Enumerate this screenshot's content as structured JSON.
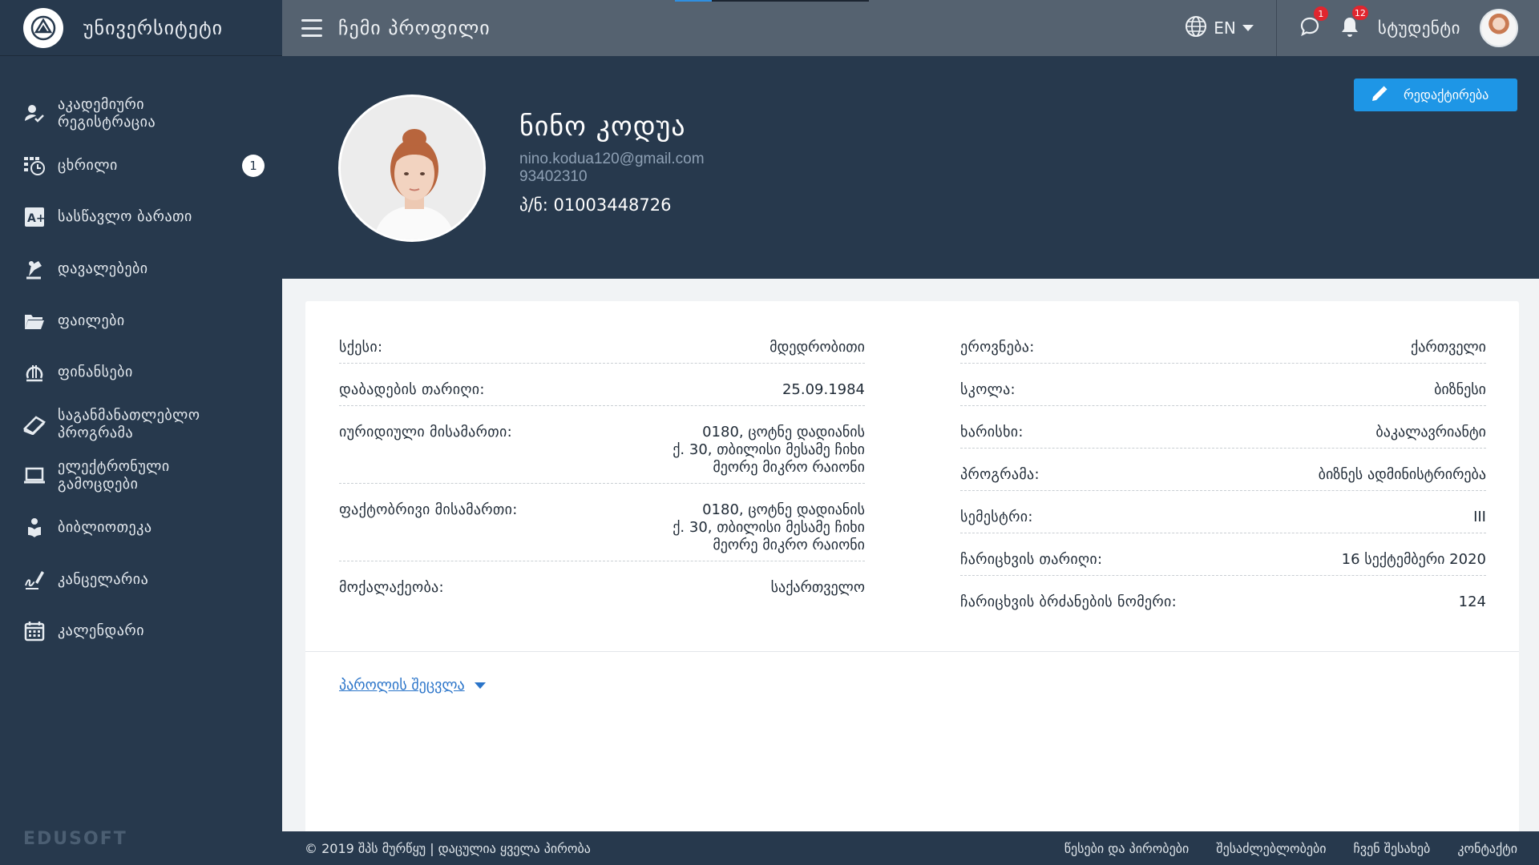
{
  "brand": {
    "name": "უნივერსიტეტი",
    "footer_logo": "EDUSOFT"
  },
  "topbar": {
    "title": "ჩემი პროფილი",
    "language": "EN",
    "messages_count": "1",
    "notifications_count": "12",
    "user_label": "სტუდენტი"
  },
  "sidebar": {
    "items": [
      {
        "label": "აკადემიური რეგისტრაცია",
        "icon": "user-check-icon"
      },
      {
        "label": "ცხრილი",
        "icon": "schedule-icon",
        "badge": "1"
      },
      {
        "label": "სასწავლო ბარათი",
        "icon": "grade-card-icon"
      },
      {
        "label": "დავალებები",
        "icon": "assignment-icon"
      },
      {
        "label": "ფაილები",
        "icon": "folder-icon"
      },
      {
        "label": "ფინანსები",
        "icon": "finance-icon"
      },
      {
        "label": "საგანმანათლებლო პროგრამა",
        "icon": "book-icon"
      },
      {
        "label": "ელექტრონული გამოცდები",
        "icon": "laptop-icon"
      },
      {
        "label": "ბიბლიოთეკა",
        "icon": "reader-icon"
      },
      {
        "label": "კანცელარია",
        "icon": "signature-icon"
      },
      {
        "label": "კალენდარი",
        "icon": "calendar-icon"
      }
    ]
  },
  "profile": {
    "name": "ნინო კოდუა",
    "email": "nino.kodua120@gmail.com",
    "phone": "93402310",
    "personal_id": "პ/ნ: 01003448726",
    "edit_label": "რედაქტირება"
  },
  "details_left": [
    {
      "key": "სქესი:",
      "value": "მდედრობითი"
    },
    {
      "key": "დაბადების თარიღი:",
      "value": "25.09.1984"
    },
    {
      "key": "იურიდიული მისამართი:",
      "value": [
        "0180, ცოტნე დადიანის",
        "ქ. 30, თბილისი მესამე ჩიხი",
        "მეორე მიკრო რაიონი"
      ]
    },
    {
      "key": "ფაქტობრივი მისამართი:",
      "value": [
        "0180, ცოტნე დადიანის",
        "ქ. 30, თბილისი მესამე ჩიხი",
        "მეორე მიკრო რაიონი"
      ]
    },
    {
      "key": "მოქალაქეობა:",
      "value": "საქართველო"
    }
  ],
  "details_right": [
    {
      "key": "ეროვნება:",
      "value": "ქართველი"
    },
    {
      "key": "სკოლა:",
      "value": "ბიზნესი"
    },
    {
      "key": "ხარისხი:",
      "value": "ბაკალავრიანტი"
    },
    {
      "key": "პროგრამა:",
      "value": "ბიზნეს ადმინისტრირება"
    },
    {
      "key": "სემესტრი:",
      "value": "III"
    },
    {
      "key": "ჩარიცხვის თარიღი:",
      "value": "16 სექტემბერი 2020"
    },
    {
      "key": "ჩარიცხვის ბრძანების ნომერი:",
      "value": "124"
    }
  ],
  "password_link": "პაროლის შეცვლა",
  "footer": {
    "copyright": "© 2019 შპს მურწყუ | დაცულია ყველა პირობა",
    "links": [
      "წესები და პირობები",
      "შესაძლებლობები",
      "ჩვენ შესახებ",
      "კონტაქტი"
    ]
  }
}
